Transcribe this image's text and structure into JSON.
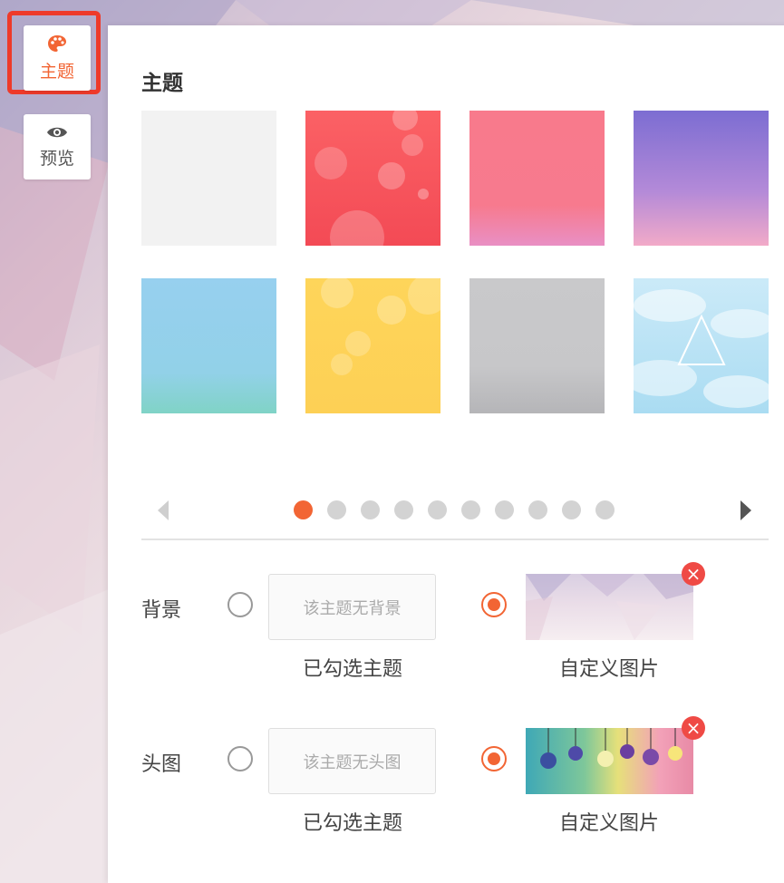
{
  "sidebar": {
    "theme_label": "主题",
    "preview_label": "预览"
  },
  "panel": {
    "title": "主题"
  },
  "swatches": [
    {
      "name": "light-gray",
      "color": "#f2f2f2"
    },
    {
      "name": "red-bokeh",
      "color": "#f5525c"
    },
    {
      "name": "pink",
      "color": "#f87a90"
    },
    {
      "name": "purple-gradient",
      "color": "#a27fd8"
    },
    {
      "name": "blue-teal",
      "color": "#8fd0e8"
    },
    {
      "name": "yellow-bokeh",
      "color": "#fed559"
    },
    {
      "name": "gray",
      "color": "#c8c8ca"
    },
    {
      "name": "sky-clouds",
      "color": "#b9e4f6"
    }
  ],
  "pager": {
    "total": 10,
    "active_index": 0,
    "active_color": "#f26534",
    "inactive_color": "#d3d3d3"
  },
  "background": {
    "label": "背景",
    "theme_option_text": "该主题无背景",
    "theme_caption": "已勾选主题",
    "custom_caption": "自定义图片",
    "selected": "custom"
  },
  "header_image": {
    "label": "头图",
    "theme_option_text": "该主题无头图",
    "theme_caption": "已勾选主题",
    "custom_caption": "自定义图片",
    "selected": "custom"
  },
  "close_symbol": "×",
  "accent_color": "#f26534",
  "icons": {
    "theme": "palette-icon",
    "preview": "eye-icon",
    "prev": "chevron-left-icon",
    "next": "chevron-right-icon",
    "remove": "close-icon"
  }
}
